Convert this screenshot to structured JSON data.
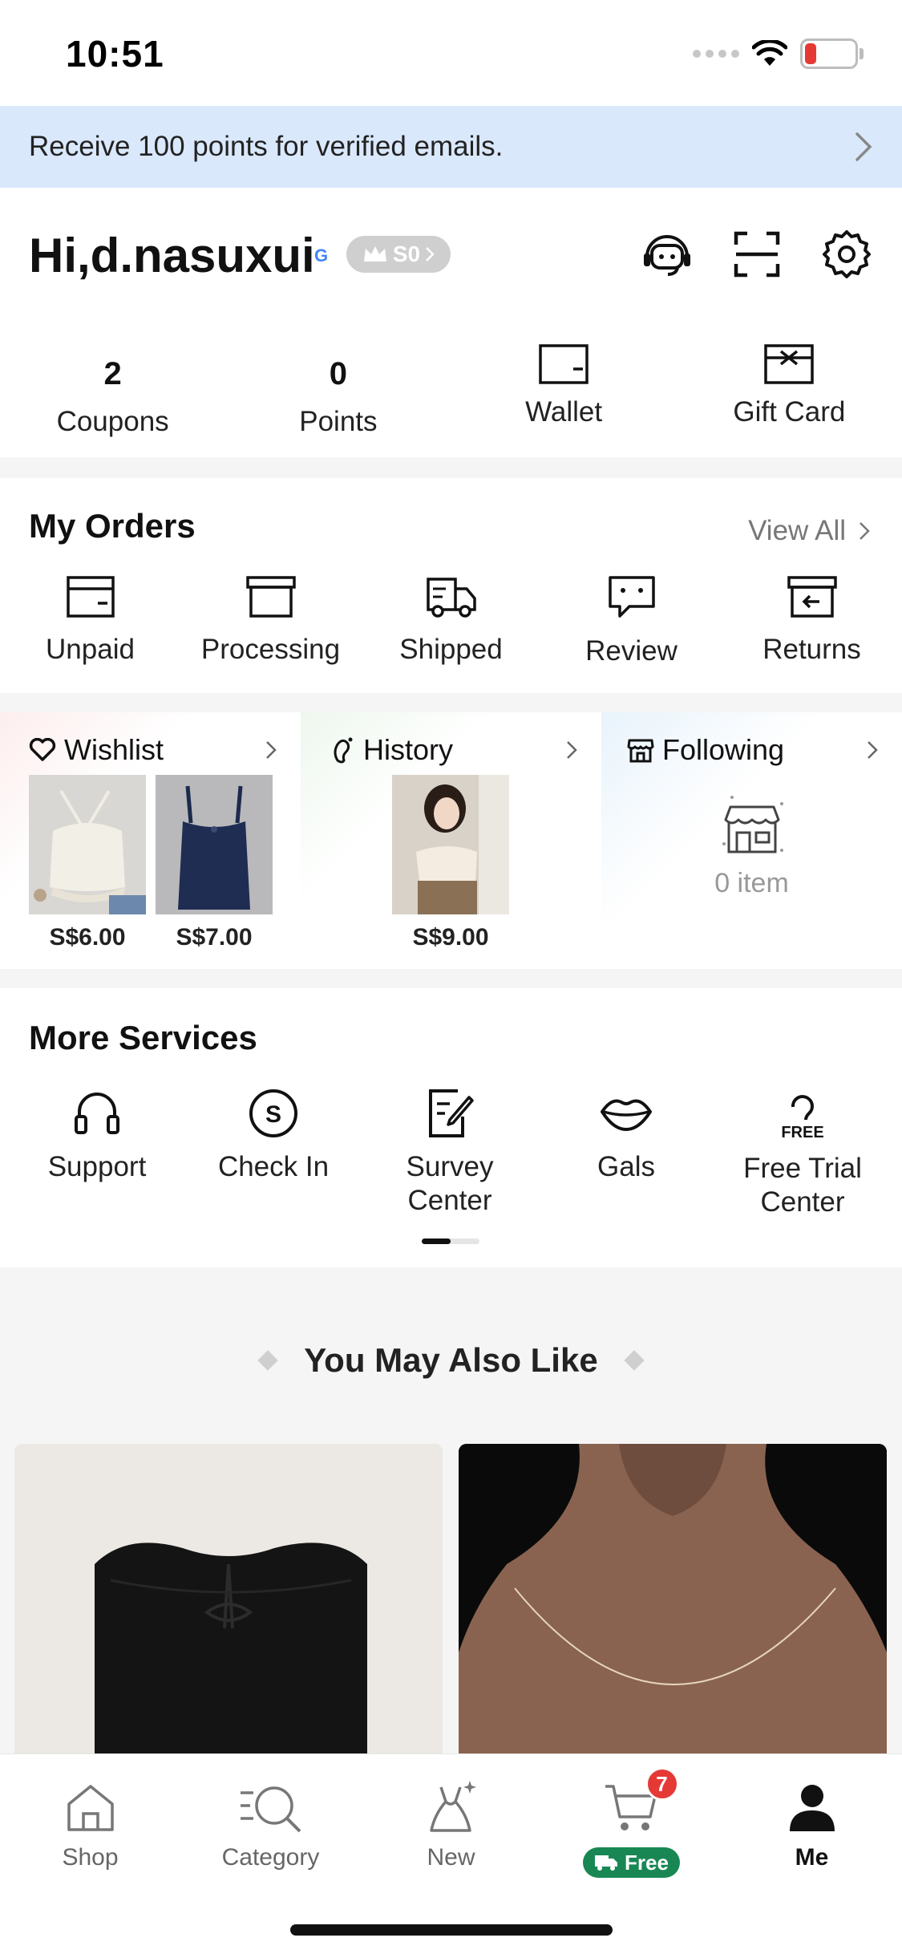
{
  "status_bar": {
    "time": "10:51",
    "battery": "13"
  },
  "banner": {
    "text": "Receive 100 points for verified emails."
  },
  "profile": {
    "greeting": "Hi,d.nasuxui",
    "login_badge": "G",
    "level": "S0"
  },
  "assets": [
    {
      "value": "2",
      "label": "Coupons"
    },
    {
      "value": "0",
      "label": "Points"
    },
    {
      "icon": "wallet-icon",
      "label": "Wallet"
    },
    {
      "icon": "gift-card-icon",
      "label": "Gift Card"
    }
  ],
  "orders": {
    "title": "My Orders",
    "view_all": "View All",
    "items": [
      {
        "label": "Unpaid",
        "icon": "unpaid-icon"
      },
      {
        "label": "Processing",
        "icon": "processing-icon"
      },
      {
        "label": "Shipped",
        "icon": "shipped-icon"
      },
      {
        "label": "Review",
        "icon": "review-icon"
      },
      {
        "label": "Returns",
        "icon": "returns-icon"
      }
    ]
  },
  "panels": {
    "wishlist": {
      "title": "Wishlist",
      "prices": [
        "S$6.00",
        "S$7.00"
      ]
    },
    "history": {
      "title": "History",
      "prices": [
        "S$9.00"
      ]
    },
    "following": {
      "title": "Following",
      "empty_text": "0 item"
    }
  },
  "services": {
    "title": "More Services",
    "items": [
      {
        "label": "Support",
        "icon": "headset-icon"
      },
      {
        "label": "Check In",
        "icon": "check-in-icon"
      },
      {
        "label": "Survey Center",
        "icon": "survey-icon"
      },
      {
        "label": "Gals",
        "icon": "lips-icon"
      },
      {
        "label": "Free Trial Center",
        "icon": "free-trial-icon"
      }
    ],
    "free_icon_text": "FREE"
  },
  "recommend": {
    "title": "You May Also Like"
  },
  "tabbar": {
    "items": [
      {
        "label": "Shop",
        "icon": "home-icon"
      },
      {
        "label": "Category",
        "icon": "category-icon"
      },
      {
        "label": "New",
        "icon": "new-icon"
      },
      {
        "label": "Free",
        "icon": "cart-icon",
        "badge": "7"
      },
      {
        "label": "Me",
        "icon": "profile-icon"
      }
    ],
    "active": "Me"
  }
}
